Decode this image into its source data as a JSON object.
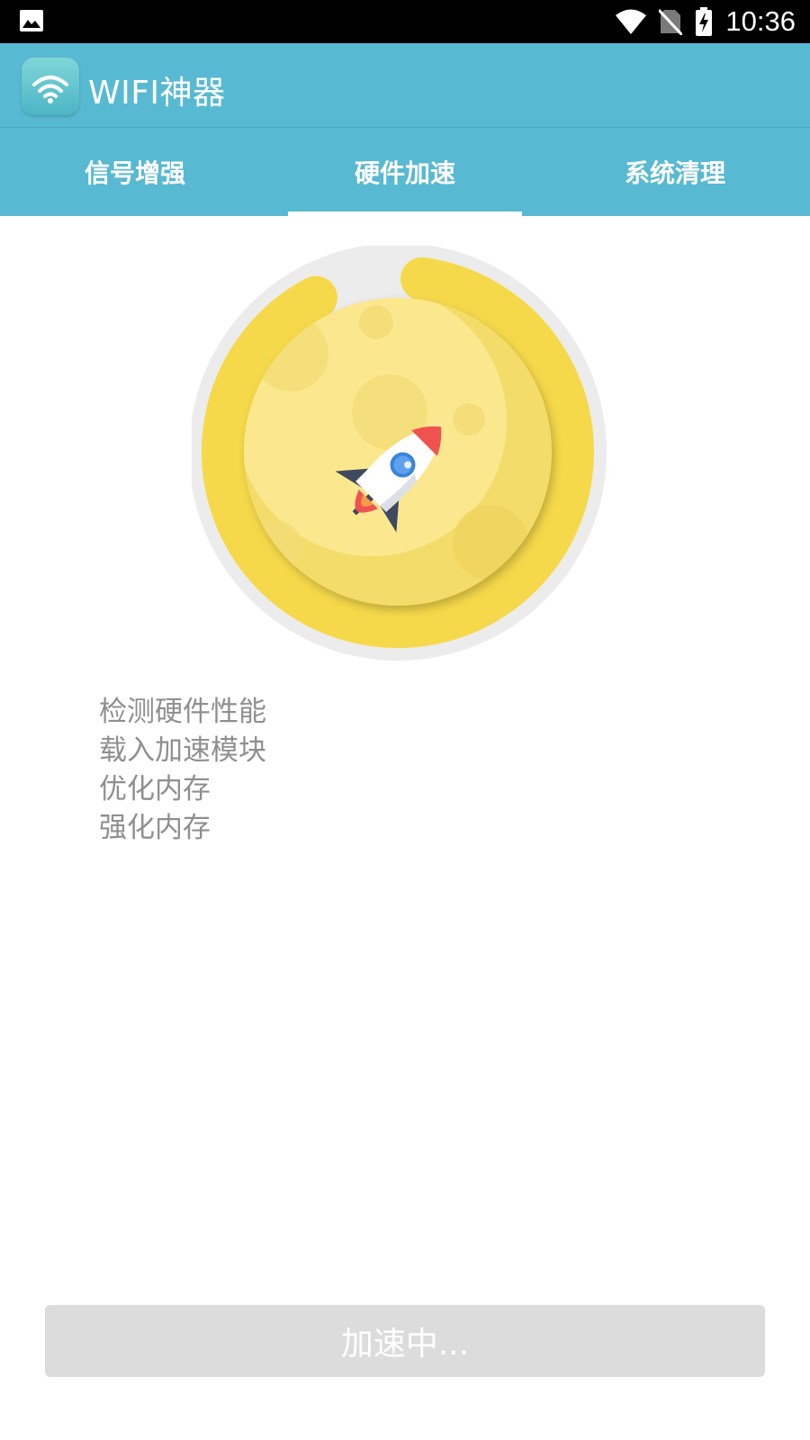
{
  "status_bar": {
    "time": "10:36",
    "icons": [
      "gallery-icon",
      "wifi-signal-icon",
      "no-sim-icon",
      "battery-charging-icon"
    ]
  },
  "app_bar": {
    "icon": "wifi-app-icon",
    "title": "WIFI神器"
  },
  "tabs": [
    {
      "label": "信号增强",
      "selected": false
    },
    {
      "label": "硬件加速",
      "selected": true
    },
    {
      "label": "系统清理",
      "selected": false
    }
  ],
  "accelerator": {
    "icon": "rocket-icon",
    "progress_percent": 90,
    "colors": {
      "ring": "#f6d94a",
      "track": "#ececec",
      "moon": "#fbe88e"
    }
  },
  "log_lines": [
    "检测硬件性能",
    "载入加速模块",
    "优化内存",
    "强化内存"
  ],
  "action_button": {
    "label": "加速中...",
    "enabled": false
  }
}
